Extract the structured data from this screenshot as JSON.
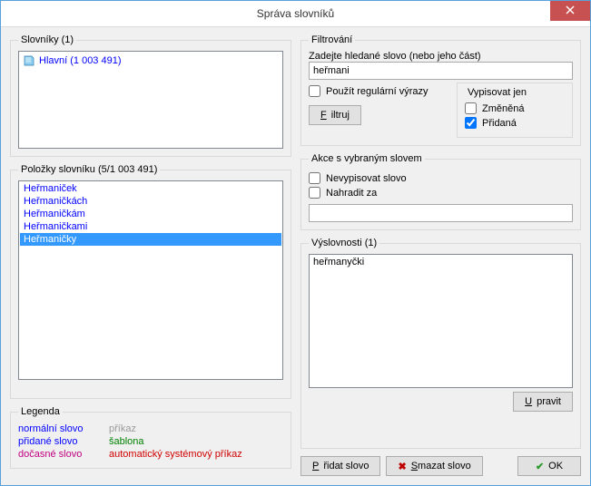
{
  "window": {
    "title": "Správa slovníků"
  },
  "dicts": {
    "heading": "Slovníky (1)",
    "items": [
      {
        "label": "Hlavní (1 003 491)"
      }
    ]
  },
  "entries": {
    "heading": "Položky slovníku (5/1 003 491)",
    "items": [
      {
        "label": "Heřmaniček"
      },
      {
        "label": "Heřmaničkách"
      },
      {
        "label": "Heřmaničkám"
      },
      {
        "label": "Heřmaničkami"
      },
      {
        "label": "Heřmaničky",
        "selected": true
      }
    ]
  },
  "legend": {
    "heading": "Legenda",
    "normal": "normální slovo",
    "added": "přidané slovo",
    "temp": "dočasné slovo",
    "cmd": "příkaz",
    "tmpl": "šablona",
    "auto": "automatický systémový příkaz"
  },
  "filter": {
    "heading": "Filtrování",
    "prompt": "Zadejte hledané slovo (nebo jeho část)",
    "value": "heřmani",
    "regex_label": "Použít regulární výrazy",
    "button": "Filtruj",
    "show_only": "Vypisovat jen",
    "changed_label": "Změněná",
    "added_label": "Přidaná",
    "changed_checked": false,
    "added_checked": true
  },
  "actions": {
    "heading": "Akce s vybraným slovem",
    "suppress_label": "Nevypisovat slovo",
    "replace_label": "Nahradit za",
    "replace_value": ""
  },
  "pron": {
    "heading": "Výslovnosti (1)",
    "items": [
      "heřmanyčki"
    ],
    "edit_btn": "Upravit"
  },
  "buttons": {
    "add": "Přidat slovo",
    "delete": "Smazat slovo",
    "ok": "OK"
  }
}
